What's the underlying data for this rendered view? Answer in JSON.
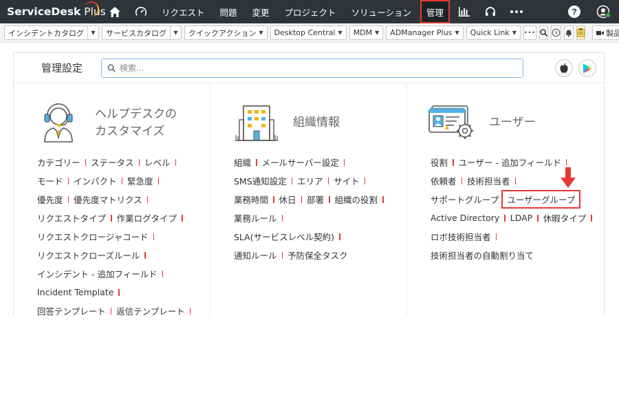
{
  "topnav": {
    "logo_main": "ServiceDesk",
    "logo_plus": " Plus",
    "items": [
      "リクエスト",
      "問題",
      "変更",
      "プロジェクト",
      "ソリューション",
      "管理"
    ],
    "icons": [
      "home-icon",
      "dashboard-icon",
      "reports-icon",
      "support-headset-icon",
      "more-dots-icon",
      "help-icon",
      "user-status-icon"
    ]
  },
  "toolbar": {
    "buttons": [
      "インシデントカタログ",
      "サービスカタログ",
      "クイックアクション",
      "Desktop Central",
      "MDM",
      "ADManager Plus",
      "Quick Link"
    ],
    "more_label": "•••",
    "extra_label": "製品"
  },
  "header": {
    "title": "管理設定",
    "search_placeholder": "検索..."
  },
  "sections": [
    {
      "title_line1": "ヘルプデスクの",
      "title_line2": "カスタマイズ",
      "rows": [
        [
          "カテゴリー",
          "ステータス",
          "レベル"
        ],
        [
          "モード",
          "インパクト",
          "緊急度"
        ],
        [
          "優先度",
          "優先度マトリクス"
        ],
        [
          "リクエストタイプ",
          "作業ログタイプ"
        ],
        [
          "リクエストクロージャコード"
        ],
        [
          "リクエストクローズルール"
        ],
        [
          "インシデント - 追加フィールド"
        ],
        [
          "Incident Template"
        ],
        [
          "回答テンプレート",
          "返信テンプレート"
        ]
      ]
    },
    {
      "title_line1": "組織情報",
      "rows": [
        [
          "組織",
          "メールサーバー設定"
        ],
        [
          "SMS通知設定",
          "エリア",
          "サイト"
        ],
        [
          "業務時間",
          "休日",
          "部署",
          "組織の役割"
        ],
        [
          "業務ルール"
        ],
        [
          "SLA(サービスレベル契約)"
        ],
        [
          "通知ルール",
          "予防保全タスク"
        ]
      ]
    },
    {
      "title_line1": "ユーザー",
      "rows": [
        [
          "役割",
          "ユーザー - 追加フィールド"
        ],
        [
          "依頼者",
          "技術担当者"
        ],
        [
          "サポートグループ",
          "ユーザーグループ"
        ],
        [
          "Active Directory",
          "LDAP",
          "休暇タイプ"
        ],
        [
          "ロボ技術担当者"
        ],
        [
          "技術担当者の自動割り当て"
        ]
      ]
    }
  ],
  "colors": {
    "accent_red": "#e53935",
    "nav_bg": "#2f3438",
    "search_border": "#7fb2e5"
  }
}
